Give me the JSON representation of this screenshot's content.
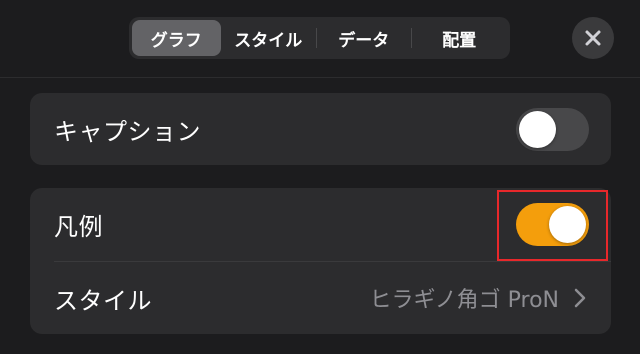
{
  "header": {
    "tabs": [
      {
        "label": "グラフ",
        "active": true
      },
      {
        "label": "スタイル",
        "active": false
      },
      {
        "label": "データ",
        "active": false
      },
      {
        "label": "配置",
        "active": false
      }
    ],
    "close_icon": "close-icon"
  },
  "settings": {
    "caption": {
      "label": "キャプション",
      "enabled": false
    },
    "legend": {
      "label": "凡例",
      "enabled": true
    },
    "style": {
      "label": "スタイル",
      "value": "ヒラギノ角ゴ ProN",
      "icon": "chevron-right-icon"
    }
  },
  "colors": {
    "background": "#1c1c1e",
    "card": "#2c2c2e",
    "toggle_on": "#f49e0c",
    "toggle_off": "#48484a",
    "highlight": "#e8282b"
  }
}
